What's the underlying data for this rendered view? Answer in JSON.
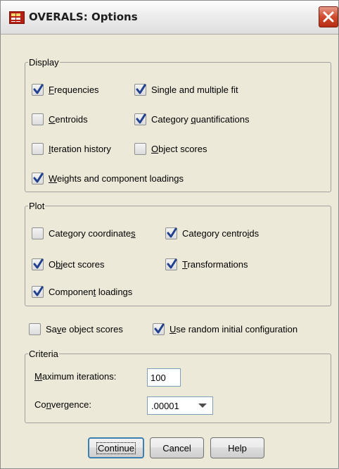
{
  "window": {
    "title": "OVERALS: Options"
  },
  "display": {
    "legend": "Display",
    "frequencies": {
      "pre": "",
      "key": "F",
      "post": "requencies",
      "checked": true
    },
    "single_multiple_fit": {
      "pre": "",
      "key": "",
      "post": "Single and multiple fit",
      "checked": true
    },
    "centroids": {
      "pre": "",
      "key": "C",
      "post": "entroids",
      "checked": false
    },
    "category_quantifications": {
      "pre": "Category ",
      "key": "q",
      "post": "uantifications",
      "checked": true
    },
    "iteration_history": {
      "pre": "",
      "key": "I",
      "post": "teration history",
      "checked": false
    },
    "object_scores": {
      "pre": "",
      "key": "O",
      "post": "bject scores",
      "checked": false
    },
    "weights_loadings": {
      "pre": "",
      "key": "W",
      "post": "eights and component loadings",
      "checked": true
    }
  },
  "plot": {
    "legend": "Plot",
    "category_coordinates": {
      "pre": "Category coordinate",
      "key": "s",
      "post": "",
      "checked": false
    },
    "category_centroids": {
      "pre": "Category centro",
      "key": "i",
      "post": "ds",
      "checked": true
    },
    "object_scores": {
      "pre": "O",
      "key": "b",
      "post": "ject scores",
      "checked": true
    },
    "transformations": {
      "pre": "",
      "key": "T",
      "post": "ransformations",
      "checked": true
    },
    "component_loadings": {
      "pre": "Componen",
      "key": "t",
      "post": " loadings",
      "checked": true
    }
  },
  "save_object_scores": {
    "pre": "Sa",
    "key": "v",
    "post": "e object scores",
    "checked": false
  },
  "use_random_config": {
    "pre": "",
    "key": "U",
    "post": "se random initial configuration",
    "checked": true
  },
  "criteria": {
    "legend": "Criteria",
    "max_iterations_label": {
      "pre": "",
      "key": "M",
      "post": "aximum iterations:"
    },
    "max_iterations_value": "100",
    "convergence_label": {
      "pre": "Co",
      "key": "n",
      "post": "vergence:"
    },
    "convergence_value": ".00001"
  },
  "buttons": {
    "continue": "Continue",
    "cancel": "Cancel",
    "help": "Help"
  },
  "colors": {
    "dialog_bg": "#ece9d8",
    "check_mark": "#21418f",
    "close_button": "#cf4a2f"
  },
  "icons": {
    "app": "spss-table-icon",
    "close": "close-icon",
    "check": "checkmark-icon",
    "dropdown": "dropdown-arrow-icon"
  }
}
